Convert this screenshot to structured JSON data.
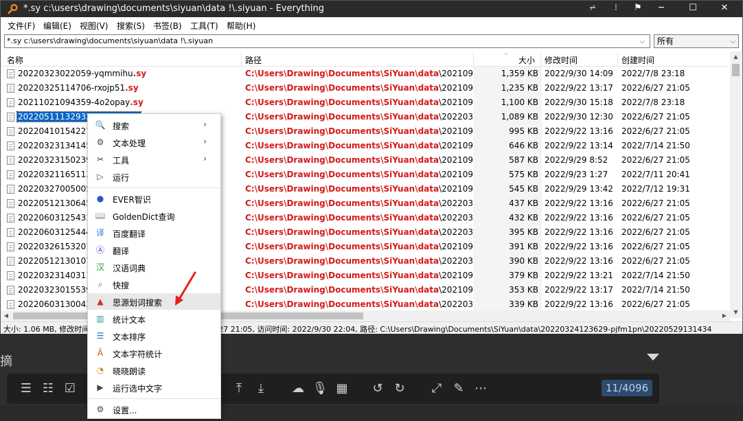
{
  "window": {
    "title": "*.sy c:\\users\\drawing\\documents\\siyuan\\data !\\.siyuan - Everything"
  },
  "menubar": [
    "文件(F)",
    "编辑(E)",
    "视图(V)",
    "搜索(S)",
    "书签(B)",
    "工具(T)",
    "帮助(H)"
  ],
  "search": {
    "value": "*.sy c:\\users\\drawing\\documents\\siyuan\\data !\\.siyuan",
    "filter": "所有"
  },
  "columns": {
    "name": "名称",
    "path": "路径",
    "size": "大小",
    "modified": "修改时间",
    "created": "创建时间"
  },
  "rows": [
    {
      "name": "20220323022059-yqmmihu",
      "ext": ".sy",
      "path_bold": "C:\\Users\\Drawing\\Documents\\SiYuan\\data",
      "path_tail": "\\2021090...",
      "size": "1,359 KB",
      "modified": "2022/9/30 14:09",
      "created": "2022/7/8 23:18"
    },
    {
      "name": "20220325114706-rxojp51",
      "ext": ".sy",
      "path_bold": "C:\\Users\\Drawing\\Documents\\SiYuan\\data",
      "path_tail": "\\2021090...",
      "size": "1,235 KB",
      "modified": "2022/9/22 13:17",
      "created": "2022/6/27 21:05"
    },
    {
      "name": "20211021094359-4o2opay",
      "ext": ".sy",
      "path_bold": "C:\\Users\\Drawing\\Documents\\SiYuan\\data",
      "path_tail": "\\2021090...",
      "size": "1,100 KB",
      "modified": "2022/9/30 15:18",
      "created": "2022/7/8 23:18"
    },
    {
      "name": "20220511132932-...",
      "ext": "",
      "path_bold": "C:\\Users\\Drawing\\Documents\\SiYuan\\data",
      "path_tail": "\\2022032...",
      "size": "1,089 KB",
      "modified": "2022/9/30 12:30",
      "created": "2022/6/27 21:05"
    },
    {
      "name": "20220410154227-",
      "ext": "",
      "path_bold": "C:\\Users\\Drawing\\Documents\\SiYuan\\data",
      "path_tail": "\\2021090...",
      "size": "995 KB",
      "modified": "2022/9/22 13:16",
      "created": "2022/6/27 21:05"
    },
    {
      "name": "20220323134145-",
      "ext": "",
      "path_bold": "C:\\Users\\Drawing\\Documents\\SiYuan\\data",
      "path_tail": "\\2021090...",
      "size": "646 KB",
      "modified": "2022/9/22 13:14",
      "created": "2022/7/14 21:50"
    },
    {
      "name": "20220323150239-",
      "ext": "",
      "path_bold": "C:\\Users\\Drawing\\Documents\\SiYuan\\data",
      "path_tail": "\\2021090...",
      "size": "587 KB",
      "modified": "2022/9/29 8:52",
      "created": "2022/6/27 21:05"
    },
    {
      "name": "20220321165113-",
      "ext": "",
      "path_bold": "C:\\Users\\Drawing\\Documents\\SiYuan\\data",
      "path_tail": "\\2021090...",
      "size": "575 KB",
      "modified": "2022/9/23 1:27",
      "created": "2022/7/11 20:41"
    },
    {
      "name": "20220327005005-",
      "ext": "",
      "path_bold": "C:\\Users\\Drawing\\Documents\\SiYuan\\data",
      "path_tail": "\\2021090...",
      "size": "545 KB",
      "modified": "2022/9/29 13:42",
      "created": "2022/7/12 19:31"
    },
    {
      "name": "20220512130645-",
      "ext": "",
      "path_bold": "C:\\Users\\Drawing\\Documents\\SiYuan\\data",
      "path_tail": "\\2022032...",
      "size": "437 KB",
      "modified": "2022/9/22 13:16",
      "created": "2022/6/27 21:05"
    },
    {
      "name": "20220603125431-",
      "ext": "",
      "path_bold": "C:\\Users\\Drawing\\Documents\\SiYuan\\data",
      "path_tail": "\\2022032...",
      "size": "432 KB",
      "modified": "2022/9/22 13:16",
      "created": "2022/6/27 21:05"
    },
    {
      "name": "20220603125444-",
      "ext": "",
      "path_bold": "C:\\Users\\Drawing\\Documents\\SiYuan\\data",
      "path_tail": "\\2022032...",
      "size": "395 KB",
      "modified": "2022/9/22 13:16",
      "created": "2022/6/27 21:05"
    },
    {
      "name": "20220326153201-",
      "ext": "",
      "path_bold": "C:\\Users\\Drawing\\Documents\\SiYuan\\data",
      "path_tail": "\\2021090...",
      "size": "391 KB",
      "modified": "2022/9/22 13:16",
      "created": "2022/6/27 21:05"
    },
    {
      "name": "20220512130107-",
      "ext": "",
      "path_bold": "C:\\Users\\Drawing\\Documents\\SiYuan\\data",
      "path_tail": "\\2022032...",
      "size": "390 KB",
      "modified": "2022/9/22 13:16",
      "created": "2022/6/27 21:05"
    },
    {
      "name": "20220323140311-",
      "ext": "",
      "path_bold": "C:\\Users\\Drawing\\Documents\\SiYuan\\data",
      "path_tail": "\\2021090...",
      "size": "379 KB",
      "modified": "2022/9/22 13:21",
      "created": "2022/7/14 21:50"
    },
    {
      "name": "20220323015539-",
      "ext": "",
      "path_bold": "C:\\Users\\Drawing\\Documents\\SiYuan\\data",
      "path_tail": "\\2021090...",
      "size": "353 KB",
      "modified": "2022/9/22 13:17",
      "created": "2022/7/14 21:50"
    },
    {
      "name": "20220603130043-",
      "ext": "",
      "path_bold": "C:\\Users\\Drawing\\Documents\\SiYuan\\data",
      "path_tail": "\\2022032...",
      "size": "339 KB",
      "modified": "2022/9/22 13:16",
      "created": "2022/6/27 21:05"
    }
  ],
  "selected_row": 3,
  "status": {
    "left": "大小: 1.06 MB, 修改时间",
    "right": "27 21:05, 访问时间: 2022/9/30 22:04, 路径: C:\\Users\\Drawing\\Documents\\SiYuan\\data\\20220324123629-pjfm1pn\\20220529131434-knuyqrw"
  },
  "context_menu": {
    "group1": [
      {
        "label": "搜索",
        "icon": "search-icon",
        "submenu": true
      },
      {
        "label": "文本处理",
        "icon": "gear-icon",
        "submenu": true
      },
      {
        "label": "工具",
        "icon": "tools-icon",
        "submenu": true
      },
      {
        "label": "运行",
        "icon": "play-icon",
        "submenu": false
      }
    ],
    "group2": [
      {
        "label": "EVER智识",
        "icon": "ever-icon"
      },
      {
        "label": "GoldenDict查询",
        "icon": "book-icon"
      },
      {
        "label": "百度翻译",
        "icon": "translate-icon"
      },
      {
        "label": "翻译",
        "icon": "translate-a-icon"
      },
      {
        "label": "汉语词典",
        "icon": "dictionary-icon"
      },
      {
        "label": "快搜",
        "icon": "quick-search-icon"
      },
      {
        "label": "思源划词搜索",
        "icon": "siyuan-icon"
      },
      {
        "label": "统计文本",
        "icon": "stats-icon"
      },
      {
        "label": "文本排序",
        "icon": "sort-icon"
      },
      {
        "label": "文本字符统计",
        "icon": "char-count-icon"
      },
      {
        "label": "晓晓朗读",
        "icon": "read-aloud-icon"
      },
      {
        "label": "运行选中文字",
        "icon": "run-selection-icon"
      }
    ],
    "group3": [
      {
        "label": "设置...",
        "icon": "settings-icon"
      }
    ],
    "hover_index": 6
  },
  "backdrop": {
    "counter": "11/4096",
    "char": "摘"
  },
  "colors": {
    "path_red": "#d41a1a",
    "selection_blue": "#0a64c8",
    "titlebar": "#2b2b2b"
  }
}
